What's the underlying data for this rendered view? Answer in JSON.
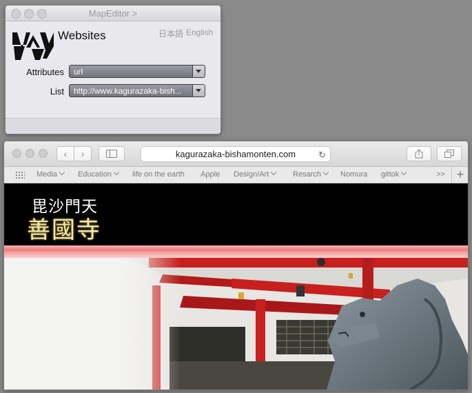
{
  "mapeditor": {
    "window_title": "MapEditor >",
    "heading": "Websites",
    "lang_japanese": "日本語",
    "lang_english": "English",
    "attributes_label": "Attributes",
    "attributes_value": "url",
    "list_label": "List",
    "list_value": "http://www.kagurazaka-bish..."
  },
  "browser": {
    "address": "kagurazaka-bishamonten.com",
    "favorites": [
      {
        "label": "Media",
        "dropdown": true
      },
      {
        "label": "Education",
        "dropdown": true
      },
      {
        "label": "life on the earth",
        "dropdown": false
      },
      {
        "label": "Apple",
        "dropdown": false
      },
      {
        "label": "Design/Art",
        "dropdown": true
      },
      {
        "label": "Resarch",
        "dropdown": true
      },
      {
        "label": "Nomura",
        "dropdown": false
      },
      {
        "label": "gittok",
        "dropdown": true
      }
    ],
    "overflow": ">>",
    "new_tab": "+"
  },
  "page": {
    "temple_name_top": "毘沙門天",
    "temple_name_bottom": "善國寺"
  },
  "colors": {
    "banner_bg": "#000000",
    "accent_stripe": "#f07c7c",
    "temple_red": "#c8201e"
  }
}
